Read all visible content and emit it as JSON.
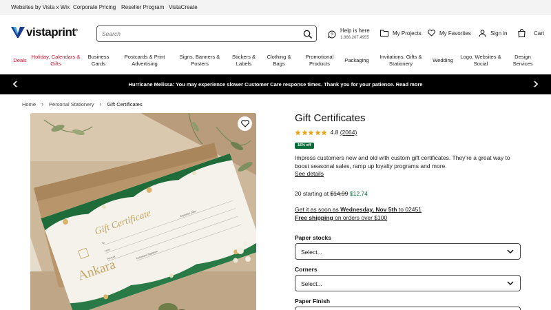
{
  "colors": {
    "accent": "#0b6b3a",
    "deal": "#c8102e",
    "banner_bg": "#000000",
    "logo_blue": "#1f3b8f"
  },
  "topbar": {
    "links": [
      "Websites by Vista x Wix",
      "Corporate Pricing",
      "Reseller Program",
      "VistaCreate"
    ]
  },
  "header": {
    "logo_text": "vistaprint",
    "logo_mark": "®",
    "search_placeholder": "Search",
    "help_label": "Help is here",
    "help_phone": "1.866.207.4955",
    "projects_label": "My Projects",
    "favorites_label": "My Favorites",
    "signin_label": "Sign in",
    "cart_label": "Cart",
    "icons": [
      "search-icon",
      "help-icon",
      "folder-icon",
      "heart-icon",
      "user-icon",
      "cart-icon"
    ]
  },
  "nav": {
    "items": [
      {
        "line1": "Deals",
        "line2": ""
      },
      {
        "line1": "Holiday, Calendars &",
        "line2": "Gifts"
      },
      {
        "line1": "Business",
        "line2": "Cards"
      },
      {
        "line1": "Postcards & Print",
        "line2": "Advertising"
      },
      {
        "line1": "Signs, Banners &",
        "line2": "Posters"
      },
      {
        "line1": "Stickers &",
        "line2": "Labels"
      },
      {
        "line1": "Clothing &",
        "line2": "Bags"
      },
      {
        "line1": "Promotional",
        "line2": "Products"
      },
      {
        "line1": "Packaging",
        "line2": ""
      },
      {
        "line1": "Invitations, Gifts &",
        "line2": "Stationery"
      },
      {
        "line1": "Wedding",
        "line2": ""
      },
      {
        "line1": "Logo, Websites &",
        "line2": "Social"
      },
      {
        "line1": "Design",
        "line2": "Services"
      }
    ]
  },
  "banner": {
    "message": "Hurricane Melissa: You may experience slower Customer Care response times. Thank you for your patience. Read more"
  },
  "breadcrumb": {
    "items": [
      "Home",
      "Personal Stationery",
      "Gift Certificates"
    ]
  },
  "product_image": {
    "card_title": "Gift Certificate",
    "brand": "Ankara",
    "field_labels": [
      "To",
      "From",
      "Amount",
      "Expiration Date",
      "Authorized Signature"
    ]
  },
  "product": {
    "title": "Gift Certificates",
    "rating_value": "4.8",
    "rating_stars": 4.8,
    "review_count": "(2064)",
    "badge": "15% off",
    "description": "Impress customers new and old with custom gift certificates. They’re a great way to boost seasonal sales, ramp up loyalty programs and more.",
    "details_link": "See details",
    "price_prefix": "20 starting at ",
    "price_old": "$14.99",
    "price_new": "$12.74",
    "ship_prefix": "Get it as soon as ",
    "ship_date": "Wednesday, Nov 5th",
    "ship_suffix": " to 02451",
    "free_shipping": "Free shipping",
    "free_shipping_rest": " on orders over $100"
  },
  "options": {
    "paper_stocks_label": "Paper stocks",
    "paper_stocks_value": "Select...",
    "corners_label": "Corners",
    "corners_value": "Select...",
    "paper_finish_label": "Paper Finish"
  }
}
